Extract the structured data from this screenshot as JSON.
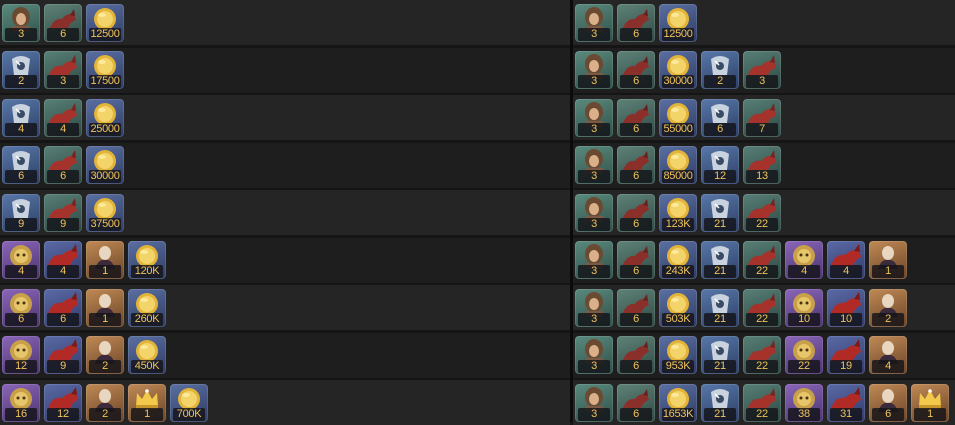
{
  "left_table": {
    "rows": [
      [
        {
          "icon": "hero-portrait-icon",
          "qty": "3"
        },
        {
          "icon": "mount-icon",
          "qty": "6"
        },
        {
          "icon": "gold-coin-icon",
          "qty": "12500"
        }
      ],
      [
        {
          "icon": "silver-armor-icon",
          "qty": "2"
        },
        {
          "icon": "red-mount-icon",
          "qty": "3"
        },
        {
          "icon": "gold-coin-icon",
          "qty": "17500"
        }
      ],
      [
        {
          "icon": "silver-armor-icon",
          "qty": "4"
        },
        {
          "icon": "red-mount-icon",
          "qty": "4"
        },
        {
          "icon": "gold-coin-icon",
          "qty": "25000"
        }
      ],
      [
        {
          "icon": "silver-armor-icon",
          "qty": "6"
        },
        {
          "icon": "red-mount-icon",
          "qty": "6"
        },
        {
          "icon": "gold-coin-icon",
          "qty": "30000"
        }
      ],
      [
        {
          "icon": "silver-armor-icon",
          "qty": "9"
        },
        {
          "icon": "red-mount-icon",
          "qty": "9"
        },
        {
          "icon": "gold-coin-icon",
          "qty": "37500"
        }
      ],
      [
        {
          "icon": "lion-helm-icon",
          "qty": "4"
        },
        {
          "icon": "crimson-mount-icon",
          "qty": "4"
        },
        {
          "icon": "bust-icon",
          "qty": "1"
        },
        {
          "icon": "gold-coin-icon",
          "qty": "120K"
        }
      ],
      [
        {
          "icon": "lion-helm-icon",
          "qty": "6"
        },
        {
          "icon": "crimson-mount-icon",
          "qty": "6"
        },
        {
          "icon": "bust-icon",
          "qty": "1"
        },
        {
          "icon": "gold-coin-icon",
          "qty": "260K"
        }
      ],
      [
        {
          "icon": "lion-helm-icon",
          "qty": "12"
        },
        {
          "icon": "crimson-mount-icon",
          "qty": "9"
        },
        {
          "icon": "bust-icon",
          "qty": "2"
        },
        {
          "icon": "gold-coin-icon",
          "qty": "450K"
        }
      ],
      [
        {
          "icon": "lion-helm-icon",
          "qty": "16"
        },
        {
          "icon": "crimson-mount-icon",
          "qty": "12"
        },
        {
          "icon": "bust-icon",
          "qty": "2"
        },
        {
          "icon": "crown-icon",
          "qty": "1"
        },
        {
          "icon": "gold-coin-icon",
          "qty": "700K"
        }
      ]
    ]
  },
  "right_table": {
    "rows": [
      [
        {
          "icon": "hero-portrait-icon",
          "qty": "3"
        },
        {
          "icon": "mount-icon",
          "qty": "6"
        },
        {
          "icon": "gold-coin-icon",
          "qty": "12500"
        }
      ],
      [
        {
          "icon": "hero-portrait-icon",
          "qty": "3"
        },
        {
          "icon": "mount-icon",
          "qty": "6"
        },
        {
          "icon": "gold-coin-icon",
          "qty": "30000"
        },
        {
          "icon": "silver-armor-icon",
          "qty": "2"
        },
        {
          "icon": "red-mount-icon",
          "qty": "3"
        }
      ],
      [
        {
          "icon": "hero-portrait-icon",
          "qty": "3"
        },
        {
          "icon": "mount-icon",
          "qty": "6"
        },
        {
          "icon": "gold-coin-icon",
          "qty": "55000"
        },
        {
          "icon": "silver-armor-icon",
          "qty": "6"
        },
        {
          "icon": "red-mount-icon",
          "qty": "7"
        }
      ],
      [
        {
          "icon": "hero-portrait-icon",
          "qty": "3"
        },
        {
          "icon": "mount-icon",
          "qty": "6"
        },
        {
          "icon": "gold-coin-icon",
          "qty": "85000"
        },
        {
          "icon": "silver-armor-icon",
          "qty": "12"
        },
        {
          "icon": "red-mount-icon",
          "qty": "13"
        }
      ],
      [
        {
          "icon": "hero-portrait-icon",
          "qty": "3"
        },
        {
          "icon": "mount-icon",
          "qty": "6"
        },
        {
          "icon": "gold-coin-icon",
          "qty": "123K"
        },
        {
          "icon": "silver-armor-icon",
          "qty": "21"
        },
        {
          "icon": "red-mount-icon",
          "qty": "22"
        }
      ],
      [
        {
          "icon": "hero-portrait-icon",
          "qty": "3"
        },
        {
          "icon": "mount-icon",
          "qty": "6"
        },
        {
          "icon": "gold-coin-icon",
          "qty": "243K"
        },
        {
          "icon": "silver-armor-icon",
          "qty": "21"
        },
        {
          "icon": "red-mount-icon",
          "qty": "22"
        },
        {
          "icon": "lion-helm-icon",
          "qty": "4"
        },
        {
          "icon": "crimson-mount-icon",
          "qty": "4"
        },
        {
          "icon": "bust-icon",
          "qty": "1"
        }
      ],
      [
        {
          "icon": "hero-portrait-icon",
          "qty": "3"
        },
        {
          "icon": "mount-icon",
          "qty": "6"
        },
        {
          "icon": "gold-coin-icon",
          "qty": "503K"
        },
        {
          "icon": "silver-armor-icon",
          "qty": "21"
        },
        {
          "icon": "red-mount-icon",
          "qty": "22"
        },
        {
          "icon": "lion-helm-icon",
          "qty": "10"
        },
        {
          "icon": "crimson-mount-icon",
          "qty": "10"
        },
        {
          "icon": "bust-icon",
          "qty": "2"
        }
      ],
      [
        {
          "icon": "hero-portrait-icon",
          "qty": "3"
        },
        {
          "icon": "mount-icon",
          "qty": "6"
        },
        {
          "icon": "gold-coin-icon",
          "qty": "953K"
        },
        {
          "icon": "silver-armor-icon",
          "qty": "21"
        },
        {
          "icon": "red-mount-icon",
          "qty": "22"
        },
        {
          "icon": "lion-helm-icon",
          "qty": "22"
        },
        {
          "icon": "crimson-mount-icon",
          "qty": "19"
        },
        {
          "icon": "bust-icon",
          "qty": "4"
        }
      ],
      [
        {
          "icon": "hero-portrait-icon",
          "qty": "3"
        },
        {
          "icon": "mount-icon",
          "qty": "6"
        },
        {
          "icon": "gold-coin-icon",
          "qty": "1653K"
        },
        {
          "icon": "silver-armor-icon",
          "qty": "21"
        },
        {
          "icon": "red-mount-icon",
          "qty": "22"
        },
        {
          "icon": "lion-helm-icon",
          "qty": "38"
        },
        {
          "icon": "crimson-mount-icon",
          "qty": "31"
        },
        {
          "icon": "bust-icon",
          "qty": "6"
        },
        {
          "icon": "crown-icon",
          "qty": "1"
        }
      ]
    ]
  },
  "colors": {
    "quantity_text": "#f0c35a",
    "row_odd": "#252525",
    "row_even": "#1e1e1e"
  }
}
